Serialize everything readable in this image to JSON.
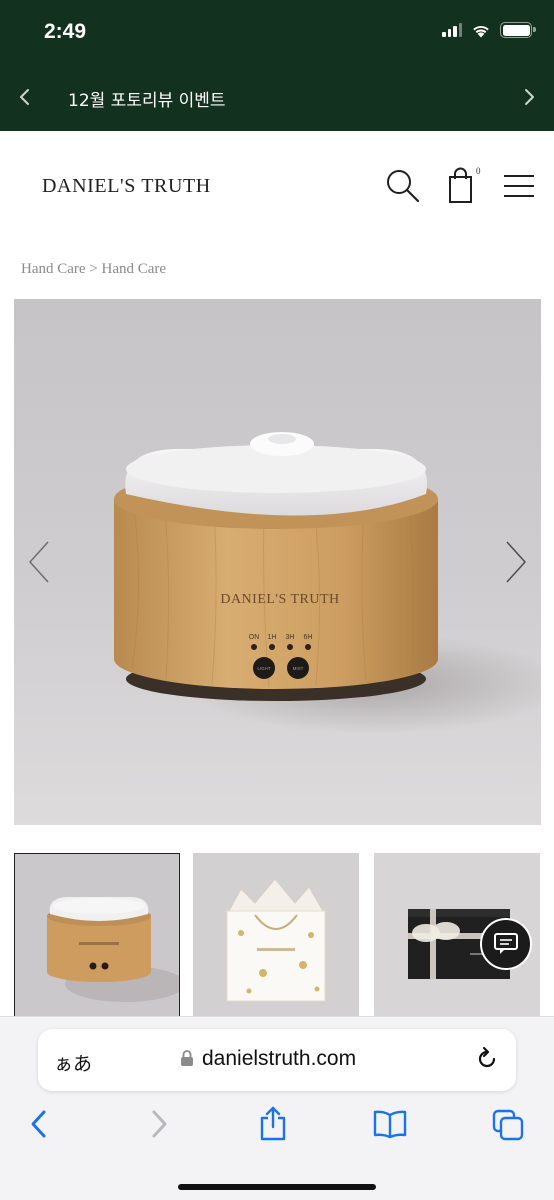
{
  "status_bar": {
    "time": "2:49",
    "icons": [
      "cellular-signal-icon",
      "wifi-icon",
      "battery-icon"
    ]
  },
  "event_banner": {
    "text": "12월 포토리뷰 이벤트",
    "prev_icon": "chevron-left-icon",
    "next_icon": "chevron-right-icon"
  },
  "header": {
    "logo": "DANIEL'S TRUTH",
    "cart_count": "0",
    "icons": [
      "search-icon",
      "shopping-bag-icon",
      "hamburger-menu-icon"
    ]
  },
  "breadcrumb": "Hand Care > Hand Care",
  "product_image": {
    "brand_print": "DANIEL'S TRUTH",
    "indicator_labels": [
      "ON",
      "1H",
      "3H",
      "6H"
    ],
    "button_labels": [
      "LIGHT",
      "MIST"
    ],
    "prev_icon": "chevron-left-icon",
    "next_icon": "chevron-right-icon"
  },
  "thumbnails": [
    {
      "name": "diffuser",
      "active": true
    },
    {
      "name": "gift-bag",
      "active": false
    },
    {
      "name": "gift-box",
      "active": false
    }
  ],
  "chat_button": {
    "icon": "chat-bubble-icon"
  },
  "safari": {
    "aa_label": "ぁあ",
    "url": "danielstruth.com",
    "toolbar_icons": [
      "back-icon",
      "forward-icon",
      "share-icon",
      "bookmarks-icon",
      "tabs-icon"
    ]
  },
  "colors": {
    "banner_green": "#13311f",
    "safari_blue": "#1a73e8",
    "wood": "#c7995e"
  }
}
